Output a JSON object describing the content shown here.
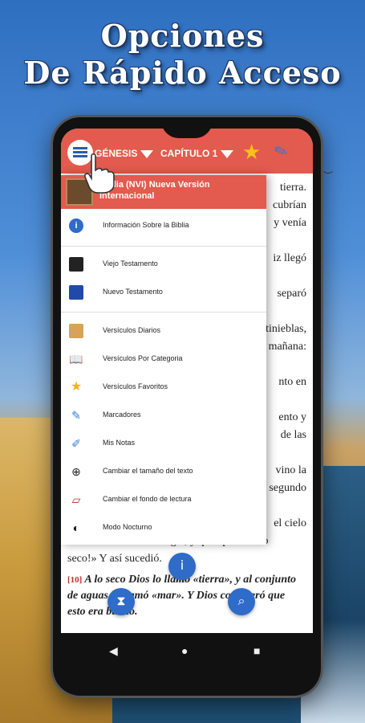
{
  "headline": {
    "line1": "Opciones",
    "line2": "De Rápido Acceso"
  },
  "topbar": {
    "book": "GÉNESIS",
    "chapter": "CAPÍTULO 1",
    "colors": {
      "bar": "#e35a4e",
      "star": "#f6c21b",
      "pen": "#2f7ad6"
    }
  },
  "drawer": {
    "title": "Biblia (NVI) Nueva Versión Internacional",
    "items": [
      {
        "icon": "info-icon",
        "label": "Información Sobre la Biblia"
      },
      {
        "icon": "book-black-icon",
        "label": "Viejo Testamento"
      },
      {
        "icon": "book-blue-icon",
        "label": "Nuevo Testamento"
      },
      {
        "icon": "open-book-icon",
        "label": "Versículos Diarios"
      },
      {
        "icon": "books-icon",
        "label": "Versículos Por Categoria"
      },
      {
        "icon": "star-icon",
        "label": "Versículos Favoritos"
      },
      {
        "icon": "marker-icon",
        "label": "Marcadores"
      },
      {
        "icon": "notes-icon",
        "label": "Mis Notas"
      },
      {
        "icon": "zoom-icon",
        "label": "Cambiar el tamaño del texto"
      },
      {
        "icon": "reading-bg-icon",
        "label": "Cambiar el fondo de lectura"
      },
      {
        "icon": "night-mode-icon",
        "label": "Modo Nocturno"
      }
    ]
  },
  "verses": {
    "right_fragments": [
      "tierra.",
      "cubrían",
      "y venía",
      "iz llegó",
      "separó",
      "tinieblas,",
      "mañana:",
      "nto en",
      "ento y",
      "de las",
      "vino la",
      "segundo"
    ],
    "line_cielo": "el cielo",
    "line_reunan": "se reúnan en un solo lugar, y que aparezca lo",
    "line_seco": "seco!» Y así sucedió.",
    "v10_num": "[10]",
    "v10_line1": "A lo seco Dios lo llamó «tierra», y al conjunto",
    "v10_line2": "de aguas lo llamó «mar». Y Dios consideró que",
    "v10_line3": "esto era bueno."
  }
}
